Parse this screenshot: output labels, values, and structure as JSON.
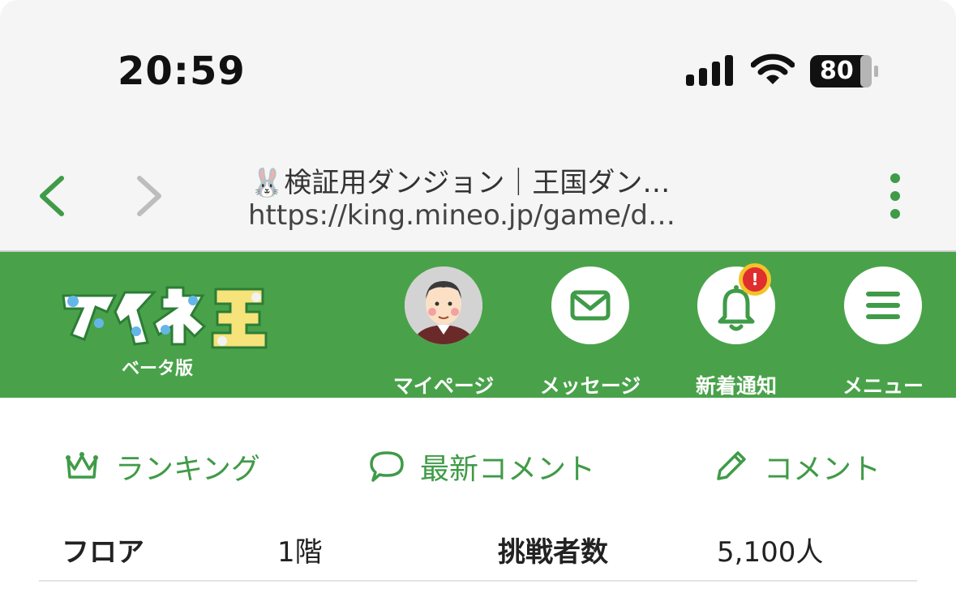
{
  "status_bar": {
    "time": "20:59",
    "battery": "80"
  },
  "browser": {
    "page_title": "🐰検証用ダンジョン｜王国ダン…",
    "url": "https://king.mineo.jp/game/d…"
  },
  "header": {
    "logo_text": "マイネ王",
    "beta_label": "ベータ版",
    "buttons": {
      "mypage": "マイページ",
      "message": "メッセージ",
      "notifications": "新着通知",
      "menu": "メニュー"
    },
    "notification_badge": "!"
  },
  "tabs": {
    "ranking": "ランキング",
    "latest_comments": "最新コメント",
    "comment": "コメント"
  },
  "info": {
    "floor_label": "フロア",
    "floor_value": "1階",
    "challengers_label": "挑戦者数",
    "challengers_value": "5,100人"
  },
  "colors": {
    "brand_green": "#49a24a",
    "accent_green": "#3f9b47",
    "badge_red": "#e02e2e",
    "badge_ring": "#f4c22b"
  },
  "icons": [
    "signal-icon",
    "wifi-icon",
    "battery-icon",
    "back-icon",
    "forward-icon",
    "more-icon",
    "avatar",
    "mail-icon",
    "bell-icon",
    "menu-icon",
    "crown-icon",
    "speech-bubble-icon",
    "pencil-icon"
  ]
}
